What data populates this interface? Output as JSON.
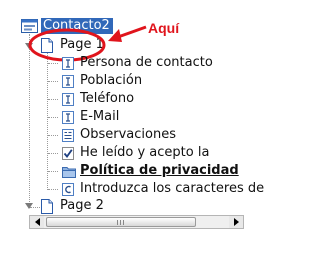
{
  "root": {
    "label": "Contacto2"
  },
  "annotation": {
    "text": "Aquí",
    "color": "#e0141c"
  },
  "tree": {
    "page1": {
      "label": "Page 1",
      "expanded": true
    },
    "items": [
      {
        "label": "Persona de contacto",
        "icon": "text-field-icon"
      },
      {
        "label": "Población",
        "icon": "text-field-icon"
      },
      {
        "label": "Teléfono",
        "icon": "text-field-icon"
      },
      {
        "label": "E-Mail",
        "icon": "text-field-icon"
      },
      {
        "label": "Observaciones",
        "icon": "textarea-icon"
      },
      {
        "label": "He leído y acepto la",
        "icon": "checkbox-checked-icon"
      },
      {
        "label": "Política de privacidad",
        "icon": "folder-icon"
      },
      {
        "label": "Introduzca los caracteres de",
        "icon": "captcha-icon"
      }
    ],
    "page2": {
      "label": "Page 2",
      "expanded": false
    }
  },
  "colors": {
    "selection": "#3168b9",
    "accent_red": "#e0141c"
  }
}
